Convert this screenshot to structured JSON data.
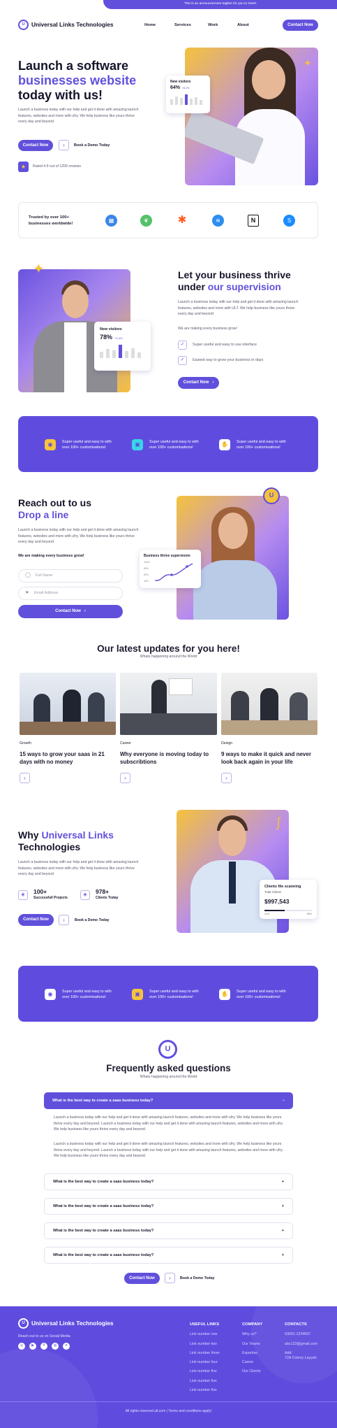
{
  "announcement": "This is an announcement tagline for you to insert",
  "brand": {
    "name": "Universal Links Technologies",
    "accent": "#6050dc",
    "logo_icon": "logo-mark-icon"
  },
  "nav": {
    "items": [
      "Home",
      "Services",
      "Work",
      "About"
    ],
    "cta": "Contact Now"
  },
  "hero": {
    "title_line1": "Launch a software",
    "title_highlight": "businesses website",
    "title_line3": "today with us!",
    "description": "Launch a business today with our help and get it done with amazing launch features, websites and more with ufry. We help business like yours thrive every day and beyond",
    "primary_cta": "Contact Now",
    "secondary_cta": "Book a Demo Today",
    "rating_text": "Rated 4.9 out of 1200 reviews",
    "stat_card": {
      "title": "New visitors",
      "value": "64%",
      "delta": "+8.2%",
      "days": [
        "M",
        "T",
        "W",
        "T",
        "F",
        "S",
        "S"
      ]
    }
  },
  "trust": {
    "text": "Trusted by over 100+ businesses worldwide!",
    "logos": [
      "calendar-logo-icon",
      "leaf-logo-icon",
      "zapier-logo-icon",
      "wave-logo-icon",
      "notion-logo-icon",
      "shazam-logo-icon"
    ]
  },
  "thrive": {
    "title_line1": "Let your business thrive",
    "title_line2_plain": "under ",
    "title_line2_highlight": "our supervision",
    "description": "Launch a business today with our help and get it done with amazing launch features, websites and more with ULT. We help business like yours thrive every day and beyond",
    "subheading": "We are making every business grow!",
    "points": [
      "Super useful and easy to use interface",
      "Easiest way to grow your business in days"
    ],
    "cta": "Contact Now",
    "stat_card": {
      "title": "New visitors",
      "value": "78%",
      "delta": "+3.4%",
      "days": [
        "M",
        "T",
        "W",
        "T",
        "F",
        "S",
        "S"
      ]
    }
  },
  "features_band_1": {
    "items": [
      {
        "line1": "Super useful and easy to with",
        "line2": "over 100+ customisations!",
        "icon": "cube-icon"
      },
      {
        "line1": "Super useful and easy to with",
        "line2": "over 100+ customisations!",
        "icon": "monitor-icon"
      },
      {
        "line1": "Super useful and easy to with",
        "line2": "over 100+ customisations!",
        "icon": "hand-icon"
      }
    ]
  },
  "contact": {
    "title_line1": "Reach out to us",
    "title_line2": "Drop a line",
    "description": "Launch a business today with our help and get it done with amazing launch features, websites and more with ufry. We help business like yours thrive every day and beyond",
    "subheading": "We are making every business grow!",
    "name_placeholder": "Full Name",
    "email_placeholder": "Email Address",
    "cta": "Contact Now",
    "chart_card": {
      "title": "Business thrive supervision",
      "ticks": [
        "100%",
        "80%",
        "60%",
        "40%"
      ]
    }
  },
  "blog": {
    "title": "Our latest updates for you here!",
    "subtitle": "Whats happening around the World",
    "posts": [
      {
        "category": "Growth",
        "title": "15 ways to grow your saas in 21 days with no money"
      },
      {
        "category": "Career",
        "title": "Why everyone is moving today to subscribtions"
      },
      {
        "category": "Design",
        "title": "9 ways to make it quick and never look back again in your life"
      }
    ]
  },
  "why": {
    "title_plain": "Why ",
    "title_highlight": "Universal Links",
    "title_line2": "Technologies",
    "description": "Launch a business today with our help and get it done with amazing launch features, websites and more with ufry. We help business like yours thrive every day and beyond",
    "stats": [
      {
        "value": "100+",
        "label": "Successfull Projects"
      },
      {
        "value": "978+",
        "label": "Clients Today"
      }
    ],
    "primary_cta": "Contact Now",
    "secondary_cta": "Book a Demo Today",
    "card": {
      "title": "Clients file scanning",
      "subtitle": "Total Clients",
      "value": "$997,543",
      "progress_low": "10%",
      "progress_high": "80%",
      "progress": 0.42
    }
  },
  "features_band_2": {
    "items": [
      {
        "line1": "Super useful and easy to with",
        "line2": "over 100+ customisations!",
        "icon": "cube-icon"
      },
      {
        "line1": "Super useful and easy to with",
        "line2": "over 100+ customisations!",
        "icon": "monitor-icon"
      },
      {
        "line1": "Super useful and easy to with",
        "line2": "over 100+ customisations!",
        "icon": "hand-icon"
      }
    ]
  },
  "faq": {
    "title": "Frequently asked questions",
    "subtitle": "Whats happening around the World",
    "open_question": "What is the best way to create a saas business today?",
    "answer_p1": "Launch a business today with our help and get it done with amazing launch features, websites and more with ufry. We help business like yours thrive every day and beyond. Launch a business today with our help and get it done with amazing launch features, websites and more with ufry. We help business like yours thrive every day and beyond.",
    "answer_p2": "Launch a business today with our help and get it done with amazing launch features, websites and more with ufry. We help business like yours thrive every day and beyond. Launch a business today with our help and get it done with amazing launch features, websites and more with ufry. We help business like yours thrive every day and beyond.",
    "questions": [
      "What is the best way to create a saas business today?",
      "What is the best way to create a saas business today?",
      "What is the best way to create a saas business today?",
      "What is the best way to create a saas business today?"
    ],
    "primary_cta": "Contact Now",
    "secondary_cta": "Book a Demo Today"
  },
  "footer": {
    "brand": "Universal Links Technologies",
    "social_text": "Reach out to us on Social Media",
    "useful_title": "USEFUL LINKS",
    "useful_links": [
      "Link number one",
      "Link number two",
      "Link number three",
      "Link number four",
      "Link number five",
      "Link number five",
      "Link number five"
    ],
    "company_title": "COMPANY",
    "company_links": [
      "Why us?",
      "Our Teams",
      "Expertise",
      "Career",
      "Our Clients"
    ],
    "contacts_title": "CONTACTS",
    "phone": "03001-1234567",
    "email": "abc123@gmail.com",
    "address_label": "Add:",
    "address": "72A Colony Layyah",
    "copyright": "All rights reserved ult.com",
    "terms": "Terms and conditions apply!"
  }
}
